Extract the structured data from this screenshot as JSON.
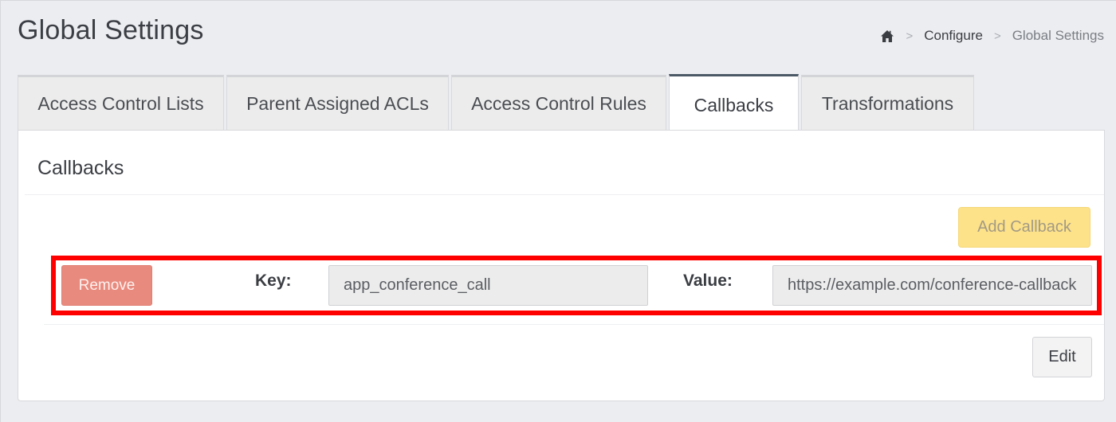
{
  "header": {
    "title": "Global Settings",
    "breadcrumb": {
      "home_icon": "home-icon",
      "separator": ">",
      "items": [
        "Configure",
        "Global Settings"
      ]
    }
  },
  "tabs": [
    {
      "label": "Access Control Lists",
      "active": false
    },
    {
      "label": "Parent Assigned ACLs",
      "active": false
    },
    {
      "label": "Access Control Rules",
      "active": false
    },
    {
      "label": "Callbacks",
      "active": true
    },
    {
      "label": "Transformations",
      "active": false
    }
  ],
  "panel": {
    "title": "Callbacks",
    "add_button_label": "Add Callback",
    "callback": {
      "remove_label": "Remove",
      "key_label": "Key:",
      "key_value": "app_conference_call",
      "value_label": "Value:",
      "value_value": "https://example.com/conference-callback"
    },
    "edit_button_label": "Edit"
  },
  "colors": {
    "active_tab_accent": "#4b5866",
    "add_button_bg": "#fde28a",
    "remove_button_bg": "#e98a7e",
    "highlight_border": "#ff0000"
  }
}
